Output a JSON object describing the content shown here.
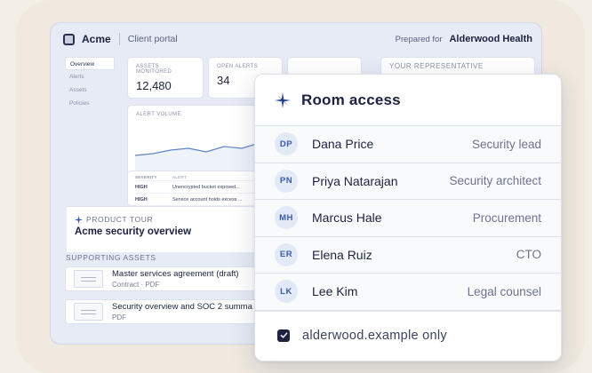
{
  "portal": {
    "brand": "Acme",
    "label": "Client portal",
    "prepared_for_label": "Prepared for",
    "client_name": "Alderwood Health",
    "nav": [
      "Overview",
      "Alerts",
      "Assets",
      "Policies"
    ],
    "stats": [
      {
        "label": "ASSETS MONITORED",
        "value": "12,480"
      },
      {
        "label": "OPEN ALERTS",
        "value": "34"
      }
    ],
    "chart_title": "ALERT VOLUME",
    "alerts_table": {
      "headers": [
        "SEVERITY",
        "ALERT"
      ],
      "rows": [
        [
          "HIGH",
          "Unencrypted bucket exposed..."
        ],
        [
          "HIGH",
          "Service account holds excess ..."
        ]
      ]
    },
    "tour": {
      "label": "PRODUCT TOUR",
      "title": "Acme security overview"
    },
    "assets_heading": "SUPPORTING ASSETS",
    "assets": [
      {
        "name": "Master services agreement (draft)",
        "meta": "Contract · PDF"
      },
      {
        "name": "Security overview and SOC 2 summa",
        "meta": "PDF"
      }
    ],
    "representative_label": "YOUR REPRESENTATIVE"
  },
  "popover": {
    "title": "Room access",
    "icon": "compass-star-icon",
    "members": [
      {
        "initials": "DP",
        "name": "Dana Price",
        "role": "Security lead"
      },
      {
        "initials": "PN",
        "name": "Priya Natarajan",
        "role": "Security architect"
      },
      {
        "initials": "MH",
        "name": "Marcus Hale",
        "role": "Procurement"
      },
      {
        "initials": "ER",
        "name": "Elena Ruiz",
        "role": "CTO"
      },
      {
        "initials": "LK",
        "name": "Lee Kim",
        "role": "Legal counsel"
      }
    ],
    "restriction": {
      "label": "alderwood.example only",
      "checked": true
    }
  },
  "colors": {
    "accent": "#1c2240",
    "avatar_bg": "#e3eaf7",
    "avatar_text": "#3a5aa8",
    "chart_line": "#5f86c8"
  }
}
